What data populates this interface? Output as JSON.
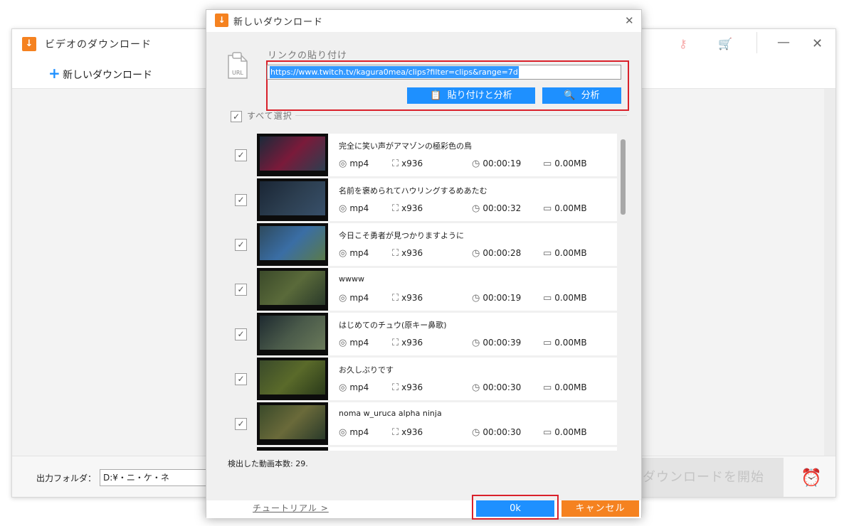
{
  "main_window": {
    "title": "ビデオのダウンロード",
    "toolbar": {
      "new_download_label": "新しいダウンロード"
    },
    "output_folder": {
      "label": "出力フォルダ：",
      "value": "D:¥・ニ・ケ・ネ"
    },
    "start_button_label": "ダウンロードを開始",
    "icons": {
      "key": "key-icon",
      "cart": "cart-icon",
      "alarm": "alarm-clock-icon"
    }
  },
  "dialog": {
    "title": "新しいダウンロード",
    "link_label": "リンクの貼り付け",
    "url_value": "https://www.twitch.tv/kagura0mea/clips?filter=clips&range=7d",
    "paste_analyze_label": "貼り付けと分析",
    "analyze_label": "分析",
    "select_all_label": "すべて選択",
    "detected_count_text": "検出した動画本数: 29.",
    "tutorial_label": "チュートリアル >",
    "ok_label": "0k",
    "cancel_label": "キャンセル",
    "accent_blue": "#1e90ff",
    "accent_orange": "#f58220",
    "highlight_red": "#d9202a"
  },
  "items": [
    {
      "title": "完全に笑い声がアマゾンの極彩色の鳥",
      "format": "mp4",
      "resolution": "x936",
      "duration": "00:00:19",
      "size": "0.00MB",
      "checked": true
    },
    {
      "title": "名前を褒められてハウリングするめあたむ",
      "format": "mp4",
      "resolution": "x936",
      "duration": "00:00:32",
      "size": "0.00MB",
      "checked": true
    },
    {
      "title": "今日こそ勇者が見つかりますように",
      "format": "mp4",
      "resolution": "x936",
      "duration": "00:00:28",
      "size": "0.00MB",
      "checked": true
    },
    {
      "title": "wwww",
      "format": "mp4",
      "resolution": "x936",
      "duration": "00:00:19",
      "size": "0.00MB",
      "checked": true
    },
    {
      "title": "はじめてのチュウ(原キー鼻歌)",
      "format": "mp4",
      "resolution": "x936",
      "duration": "00:00:39",
      "size": "0.00MB",
      "checked": true
    },
    {
      "title": "お久しぶりです",
      "format": "mp4",
      "resolution": "x936",
      "duration": "00:00:30",
      "size": "0.00MB",
      "checked": true
    },
    {
      "title": "noma w_uruca alpha ninja",
      "format": "mp4",
      "resolution": "x936",
      "duration": "00:00:30",
      "size": "0.00MB",
      "checked": true
    }
  ]
}
